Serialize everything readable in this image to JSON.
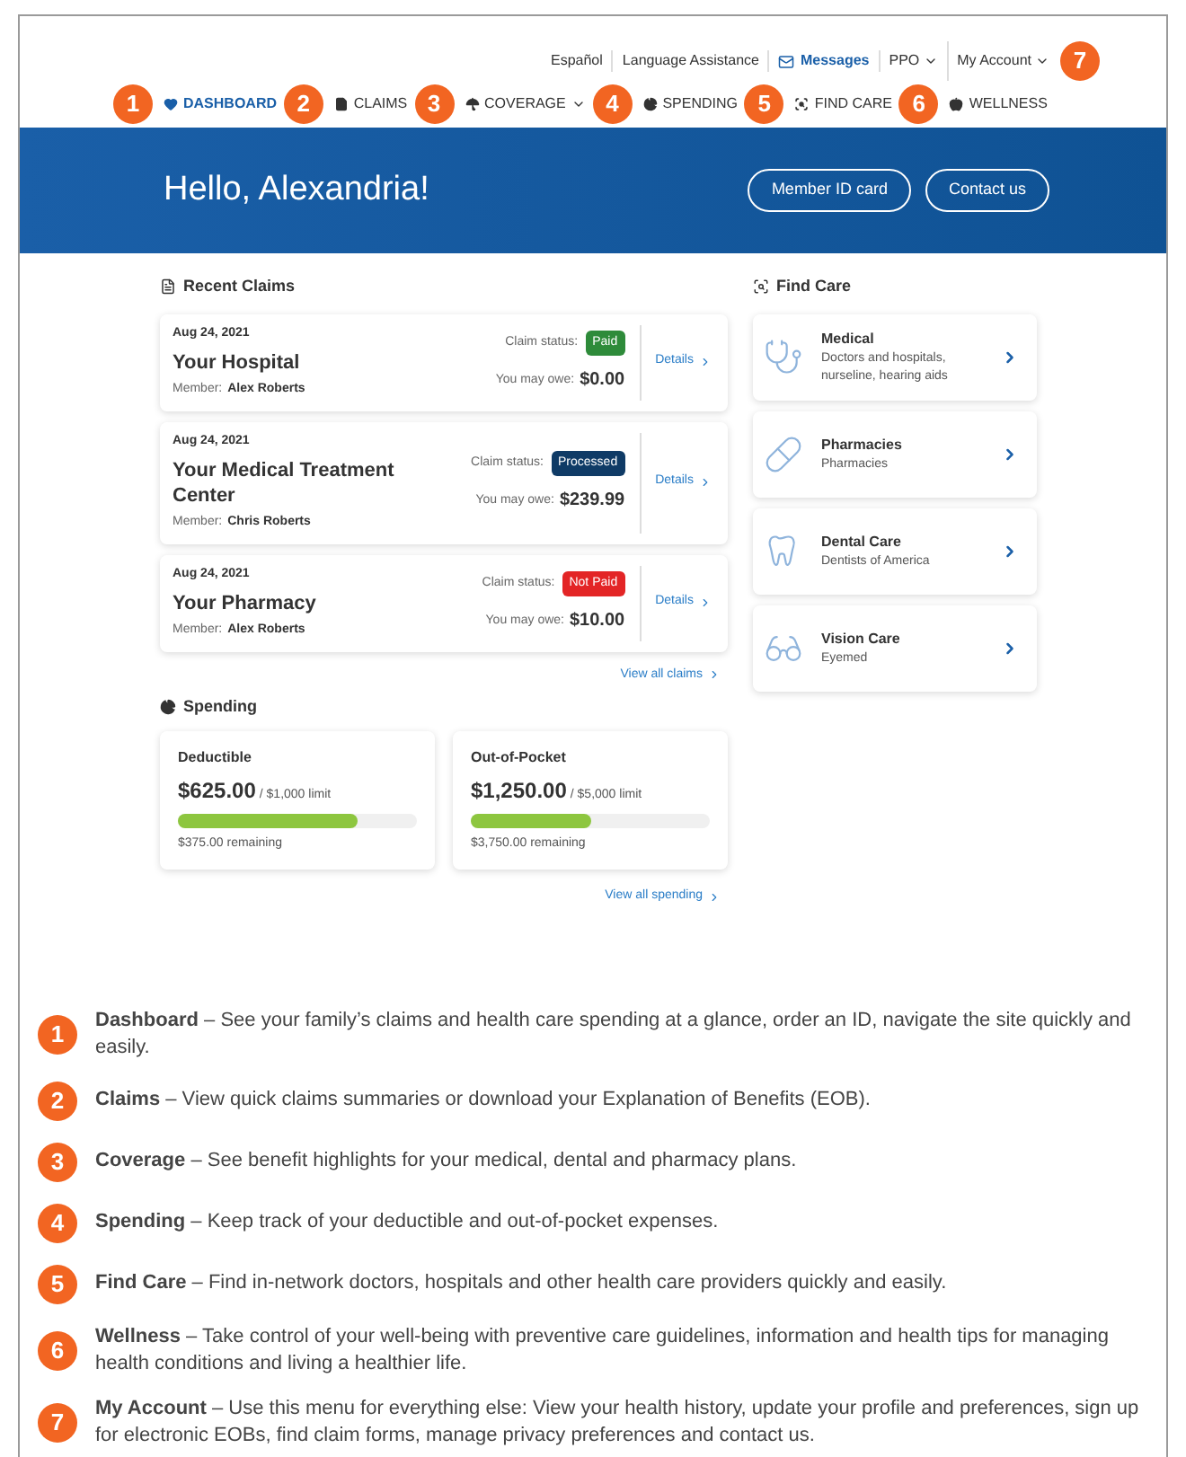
{
  "utility_links": [
    {
      "label": "Español",
      "kind": "link"
    },
    {
      "label": "Language Assistance",
      "kind": "link"
    },
    {
      "label": "Messages",
      "kind": "messages"
    },
    {
      "label": "PPO",
      "kind": "dropdown"
    },
    {
      "label": "My Account",
      "kind": "dropdown",
      "badge": "7"
    }
  ],
  "nav": [
    {
      "label": "DASHBOARD",
      "badge": "1",
      "selected": true,
      "dropdown": false
    },
    {
      "label": "CLAIMS",
      "badge": "2",
      "selected": false,
      "dropdown": false
    },
    {
      "label": "COVERAGE",
      "badge": "3",
      "selected": false,
      "dropdown": true
    },
    {
      "label": "SPENDING",
      "badge": "4",
      "selected": false,
      "dropdown": false
    },
    {
      "label": "FIND CARE",
      "badge": "5",
      "selected": false,
      "dropdown": false
    },
    {
      "label": "WELLNESS",
      "badge": "6",
      "selected": false,
      "dropdown": false
    }
  ],
  "banner": {
    "greeting": "Hello, Alexandria!",
    "buttons": [
      "Member ID card",
      "Contact us"
    ]
  },
  "recent_claims": {
    "title": "Recent Claims",
    "claims": [
      {
        "date": "Aug 24, 2021",
        "provider": "Your Hospital",
        "member_label": "Member:",
        "member": "Alex Roberts",
        "status_label": "Claim status:",
        "status": "Paid",
        "color": "#2e8b3a",
        "owe_label": "You may owe:",
        "owe": "$0.00",
        "link": "Details"
      },
      {
        "date": "Aug 24, 2021",
        "provider": "Your Medical Treatment Center",
        "member_label": "Member:",
        "member": "Chris Roberts",
        "status_label": "Claim status:",
        "status": "Processed",
        "color": "#0f3b66",
        "owe_label": "You may owe:",
        "owe": "$239.99",
        "link": "Details"
      },
      {
        "date": "Aug 24, 2021",
        "provider": "Your Pharmacy",
        "member_label": "Member:",
        "member": "Alex Roberts",
        "status_label": "Claim status:",
        "status": "Not Paid",
        "color": "#e32526",
        "owe_label": "You may owe:",
        "owe": "$10.00",
        "link": "Details"
      }
    ],
    "view_all": "View all claims"
  },
  "find_care": {
    "title": "Find Care",
    "items": [
      {
        "title": "Medical",
        "subtitle": "Doctors and hospitals, nurseline, hearing aids"
      },
      {
        "title": "Pharmacies",
        "subtitle": "Pharmacies"
      },
      {
        "title": "Dental Care",
        "subtitle": "Dentists of America"
      },
      {
        "title": "Vision Care",
        "subtitle": "Eyemed"
      }
    ]
  },
  "spending": {
    "title": "Spending",
    "cards": [
      {
        "title": "Deductible",
        "amount": "$625.00",
        "limit": "/ $1,000 limit",
        "level": 0.75,
        "remaining": "$375.00 remaining"
      },
      {
        "title": "Out-of-Pocket",
        "amount": "$1,250.00",
        "limit": "/ $5,000 limit",
        "level": 0.5,
        "remaining": "$3,750.00 remaining"
      }
    ],
    "view_all": "View all spending"
  },
  "legend": [
    {
      "badge": "1",
      "text": "**Dashboard** – See your family’s claims and health care spending at a glance, order an ID, navigate the site quickly and easily."
    },
    {
      "badge": "2",
      "text": "**Claims** – View quick claims summaries or download your Explanation of Benefits (EOB)."
    },
    {
      "badge": "3",
      "text": "**Coverage** – See benefit highlights for your medical, dental and pharmacy plans."
    },
    {
      "badge": "4",
      "text": "**Spending** – Keep track of your deductible and out-of-pocket expenses."
    },
    {
      "badge": "5",
      "text": "**Find Care** – Find in-network doctors, hospitals and other health care providers quickly and easily."
    },
    {
      "badge": "6",
      "text": "**Wellness** – Take control of your well-being with preventive care guidelines, information and health tips for managing health conditions and living a healthier life."
    },
    {
      "badge": "7",
      "text": "**My Account** – Use this menu for everything else: View your health history, update your profile and preferences, sign up for electronic EOBs, find claim forms, manage privacy preferences and contact us."
    }
  ]
}
